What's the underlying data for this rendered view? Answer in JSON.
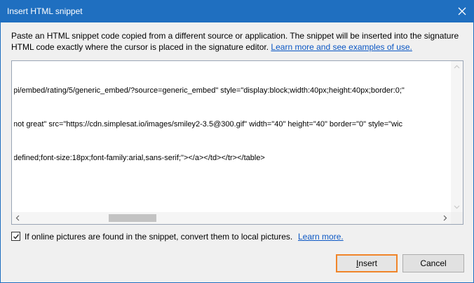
{
  "window": {
    "title": "Insert HTML snippet"
  },
  "description": {
    "text": "Paste an HTML snippet code copied from a different source or application. The snippet will be inserted into the signature HTML code exactly where the cursor is placed in the signature editor.",
    "link": "Learn more and see examples of use."
  },
  "editor": {
    "lines": [
      "pi/embed/rating/5/generic_embed/?source=generic_embed\" style=\"display:block;width:40px;height:40px;border:0;\"",
      "not great\" src=\"https://cdn.simplesat.io/images/smiley2-3.5@300.gif\" width=\"40\" height=\"40\" border=\"0\" style=\"wic",
      "defined;font-size:18px;font-family:arial,sans-serif;\"></a></td></tr></table>"
    ]
  },
  "option": {
    "checked": true,
    "label": "If online pictures are found in the snippet, convert them to local pictures.",
    "link": "Learn more."
  },
  "buttons": {
    "insert_first": "I",
    "insert_rest": "nsert",
    "cancel": "Cancel"
  },
  "colors": {
    "titlebar": "#1f6fc0",
    "link": "#0b57c4",
    "focus_border": "#f0852a"
  }
}
